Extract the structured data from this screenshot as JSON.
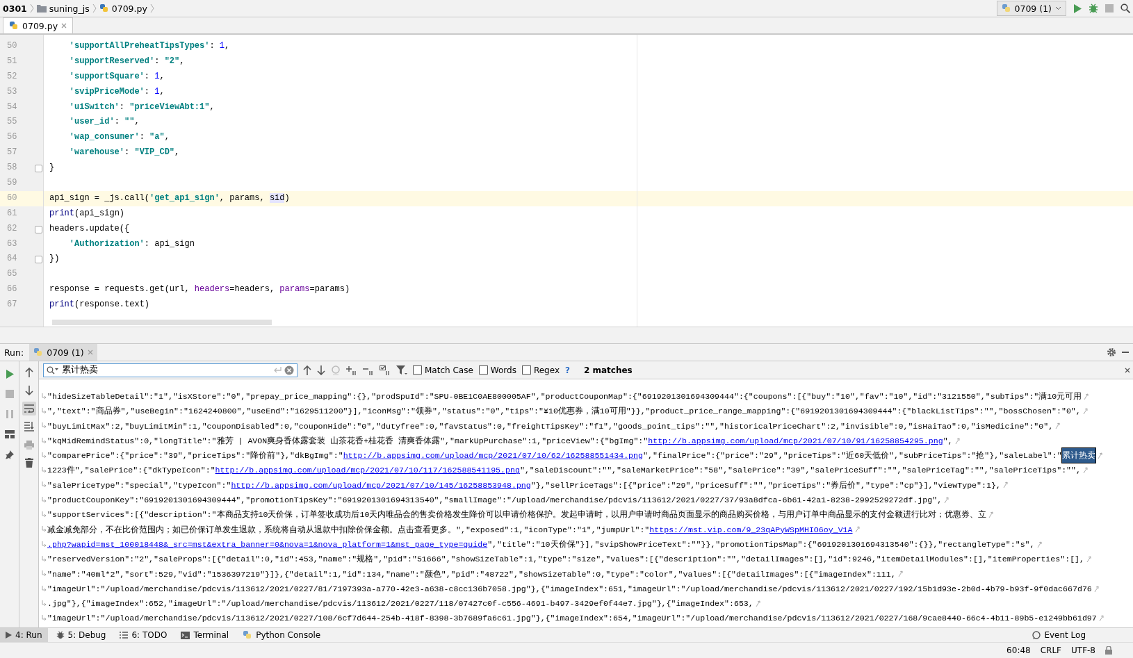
{
  "breadcrumbs": [
    {
      "label": "0301",
      "kind": "project"
    },
    {
      "label": "suning_js",
      "kind": "folder"
    },
    {
      "label": "0709.py",
      "kind": "file"
    }
  ],
  "run_config": {
    "label": "0709 (1)"
  },
  "editor_tabs": [
    {
      "label": "0709.py",
      "selected": true
    }
  ],
  "editor": {
    "lines": [
      {
        "number": "50",
        "tokens": [
          {
            "kind": "key",
            "text": "    'supportAllPreheatTipsTypes'"
          },
          {
            "kind": "plain",
            "text": ": "
          },
          {
            "kind": "num",
            "text": "1"
          },
          {
            "kind": "plain",
            "text": ","
          }
        ]
      },
      {
        "number": "51",
        "tokens": [
          {
            "kind": "key",
            "text": "    'supportReserved'"
          },
          {
            "kind": "plain",
            "text": ": "
          },
          {
            "kind": "key",
            "text": "\"2\""
          },
          {
            "kind": "plain",
            "text": ","
          }
        ]
      },
      {
        "number": "52",
        "tokens": [
          {
            "kind": "key",
            "text": "    'supportSquare'"
          },
          {
            "kind": "plain",
            "text": ": "
          },
          {
            "kind": "num",
            "text": "1"
          },
          {
            "kind": "plain",
            "text": ","
          }
        ]
      },
      {
        "number": "53",
        "tokens": [
          {
            "kind": "key",
            "text": "    'svipPriceMode'"
          },
          {
            "kind": "plain",
            "text": ": "
          },
          {
            "kind": "num",
            "text": "1"
          },
          {
            "kind": "plain",
            "text": ","
          }
        ]
      },
      {
        "number": "54",
        "tokens": [
          {
            "kind": "key",
            "text": "    'uiSwitch'"
          },
          {
            "kind": "plain",
            "text": ": "
          },
          {
            "kind": "key",
            "text": "\"priceViewAbt:1\""
          },
          {
            "kind": "plain",
            "text": ","
          }
        ]
      },
      {
        "number": "55",
        "tokens": [
          {
            "kind": "key",
            "text": "    'user_id'"
          },
          {
            "kind": "plain",
            "text": ": "
          },
          {
            "kind": "key",
            "text": "\"\""
          },
          {
            "kind": "plain",
            "text": ","
          }
        ]
      },
      {
        "number": "56",
        "tokens": [
          {
            "kind": "key",
            "text": "    'wap_consumer'"
          },
          {
            "kind": "plain",
            "text": ": "
          },
          {
            "kind": "key",
            "text": "\"a\""
          },
          {
            "kind": "plain",
            "text": ","
          }
        ]
      },
      {
        "number": "57",
        "tokens": [
          {
            "kind": "key",
            "text": "    'warehouse'"
          },
          {
            "kind": "plain",
            "text": ": "
          },
          {
            "kind": "key",
            "text": "\"VIP_CD\""
          },
          {
            "kind": "plain",
            "text": ","
          }
        ]
      },
      {
        "number": "58",
        "fold": true,
        "tokens": [
          {
            "kind": "plain",
            "text": "}"
          }
        ]
      },
      {
        "number": "59"
      },
      {
        "number": "60",
        "current": true,
        "tokens": [
          {
            "kind": "plain",
            "text": "api_sign = _js.call("
          },
          {
            "kind": "key",
            "text": "'get_api_sign'"
          },
          {
            "kind": "plain",
            "text": ", params, "
          },
          {
            "kind": "usage",
            "text": "sid"
          },
          {
            "kind": "plain",
            "text": ")"
          }
        ]
      },
      {
        "number": "61",
        "tokens": [
          {
            "kind": "builtin",
            "text": "print"
          },
          {
            "kind": "plain",
            "text": "(api_sign)"
          }
        ]
      },
      {
        "number": "62",
        "fold": true,
        "tokens": [
          {
            "kind": "plain",
            "text": "headers.update({"
          }
        ]
      },
      {
        "number": "63",
        "tokens": [
          {
            "kind": "key",
            "text": "    'Authorization'"
          },
          {
            "kind": "plain",
            "text": ": api_sign"
          }
        ]
      },
      {
        "number": "64",
        "fold": true,
        "tokens": [
          {
            "kind": "plain",
            "text": "})"
          }
        ]
      },
      {
        "number": "65"
      },
      {
        "number": "66",
        "tokens": [
          {
            "kind": "plain",
            "text": "response = requests.get(url, "
          },
          {
            "kind": "param",
            "text": "headers"
          },
          {
            "kind": "plain",
            "text": "=headers, "
          },
          {
            "kind": "param",
            "text": "params"
          },
          {
            "kind": "plain",
            "text": "=params)"
          }
        ]
      },
      {
        "number": "67",
        "tokens": [
          {
            "kind": "builtin",
            "text": "print"
          },
          {
            "kind": "plain",
            "text": "(response.text)"
          }
        ]
      }
    ]
  },
  "run_panel": {
    "title": "Run:",
    "tabs": [
      {
        "label": "0709 (1)",
        "selected": true
      }
    ],
    "search": {
      "value": "累计热卖",
      "options": [
        {
          "label": "Match Case",
          "checked": false
        },
        {
          "label": "Words",
          "checked": false
        },
        {
          "label": "Regex",
          "checked": false
        }
      ],
      "help": "?",
      "match_count": "2 matches"
    },
    "soft_wrap_on": true,
    "console_lines": [
      [
        {
          "kind": "text",
          "text": "\"hideSizeTableDetail\":\"1\",\"isXStore\":\"0\",\"prepay_price_mapping\":{},\"prodSpuId\":\"SPU-0BE1C0AE800005AF\",\"productCouponMap\":{\"6919201301694309444\":{\"coupons\":[{\"buy\":\"10\",\"fav\":\"10\",\"id\":\"3121550\",\"subTips\":\"满10元可用"
        }
      ],
      [
        {
          "kind": "text",
          "text": "\",\"text\":\"商品券\",\"useBegin\":\"1624240800\",\"useEnd\":\"1629511200\"}],\"iconMsg\":\"领券\",\"status\":\"0\",\"tips\":\"¥10优惠券，满10可用\"}},\"product_price_range_mapping\":{\"6919201301694309444\":{\"blackListTips\":\"\",\"bossChosen\":\"0\","
        }
      ],
      [
        {
          "kind": "text",
          "text": "\"buyLimitMax\":2,\"buyLimitMin\":1,\"couponDisabled\":0,\"couponHide\":\"0\",\"dutyfree\":0,\"favStatus\":0,\"freightTipsKey\":\"f1\",\"goods_point_tips\":\"\",\"historicalPriceChart\":2,\"invisible\":0,\"isHaiTao\":0,\"isMedicine\":\"0\","
        }
      ],
      [
        {
          "kind": "text",
          "text": "\"kqMidRemindStatus\":0,\"longTitle\":\"雅芳 | AVON爽身香体露套装 山茶花香+桂花香 清爽香体露\",\"markUpPurchase\":1,\"priceView\":{\"bgImg\":\""
        },
        {
          "kind": "link",
          "text": "http://b.appsimg.com/upload/mcp/2021/07/10/91/16258854295.png"
        },
        {
          "kind": "text",
          "text": "\","
        }
      ],
      [
        {
          "kind": "text",
          "text": "\"comparePrice\":{\"price\":\"39\",\"priceTips\":\"降价前\"},\"dkBgImg\":\""
        },
        {
          "kind": "link",
          "text": "http://b.appsimg.com/upload/mcp/2021/07/10/62/162588551434.png"
        },
        {
          "kind": "text",
          "text": "\",\"finalPrice\":{\"price\":\"29\",\"priceTips\":\"近60天低价\",\"subPriceTips\":\"抢\"},\"saleLabel\":\""
        },
        {
          "kind": "match",
          "text": "累计热卖"
        }
      ],
      [
        {
          "kind": "text",
          "text": "1223件\",\"salePrice\":{\"dkTypeIcon\":\""
        },
        {
          "kind": "link",
          "text": "http://b.appsimg.com/upload/mcp/2021/07/10/117/162588541195.png"
        },
        {
          "kind": "text",
          "text": "\",\"saleDiscount\":\"\",\"saleMarketPrice\":\"58\",\"salePrice\":\"39\",\"salePriceSuff\":\"\",\"salePriceTag\":\"\",\"salePriceTips\":\"\","
        }
      ],
      [
        {
          "kind": "text",
          "text": "\"salePriceType\":\"special\",\"typeIcon\":\""
        },
        {
          "kind": "link",
          "text": "http://b.appsimg.com/upload/mcp/2021/07/10/145/16258853948.png"
        },
        {
          "kind": "text",
          "text": "\"},\"sellPriceTags\":[{\"price\":\"29\",\"priceSuff\":\"\",\"priceTips\":\"券后价\",\"type\":\"cp\"}],\"viewType\":1},"
        }
      ],
      [
        {
          "kind": "text",
          "text": "\"productCouponKey\":\"6919201301694309444\",\"promotionTipsKey\":\"6919201301694313540\",\"smallImage\":\"/upload/merchandise/pdcvis/113612/2021/0227/37/93a8dfca-6b61-42a1-8238-2992529272df.jpg\","
        }
      ],
      [
        {
          "kind": "text",
          "text": "\"supportServices\":[{\"description\":\"本商品支持10天价保，订单签收成功后10天内唯品会的售卖价格发生降价可以申请价格保护。发起申请时，以用户申请时商品页面显示的商品购买价格，与用户订单中商品显示的支付金额进行比对；优惠券、立"
        }
      ],
      [
        {
          "kind": "text",
          "text": "减金减免部分，不在比价范围内；如已价保订单发生退款，系统将自动从退款中扣除价保金额。点击查看更多。\",\"exposed\":1,\"iconType\":\"1\",\"jumpUrl\":\""
        },
        {
          "kind": "link",
          "text": "https://mst.vip.com/9_23qAPyWSpMHIO6oy_V1A"
        }
      ],
      [
        {
          "kind": "link",
          "text": ".php?wapid=mst_100018448&_src=mst&extra_banner=0&nova=1&nova_platform=1&mst_page_type=guide"
        },
        {
          "kind": "text",
          "text": "\",\"title\":\"10天价保\"}],\"svipShowPriceText\":\"\"}},\"promotionTipsMap\":{\"6919201301694313540\":{}},\"rectangleType\":\"s\","
        }
      ],
      [
        {
          "kind": "text",
          "text": "\"reservedVersion\":\"2\",\"saleProps\":[{\"detail\":0,\"id\":453,\"name\":\"规格\",\"pid\":\"51666\",\"showSizeTable\":1,\"type\":\"size\",\"values\":[{\"description\":\"\",\"detailImages\":[],\"id\":9246,\"itemDetailModules\":[],\"itemProperties\":[],"
        }
      ],
      [
        {
          "kind": "text",
          "text": "\"name\":\"40ml*2\",\"sort\":529,\"vid\":\"1536397219\"}]},{\"detail\":1,\"id\":134,\"name\":\"颜色\",\"pid\":\"48722\",\"showSizeTable\":0,\"type\":\"color\",\"values\":[{\"detailImages\":[{\"imageIndex\":111,"
        }
      ],
      [
        {
          "kind": "text",
          "text": "\"imageUrl\":\"/upload/merchandise/pdcvis/113612/2021/0227/81/7197393a-a770-42e3-a638-c8cc136b7058.jpg\"},{\"imageIndex\":651,\"imageUrl\":\"/upload/merchandise/pdcvis/113612/2021/0227/192/15b1d93e-2b0d-4b79-b93f-9f0dac667d76"
        }
      ],
      [
        {
          "kind": "text",
          "text": ".jpg\"},{\"imageIndex\":652,\"imageUrl\":\"/upload/merchandise/pdcvis/113612/2021/0227/118/07427c0f-c556-4691-b497-3429ef0f44e7.jpg\"},{\"imageIndex\":653,"
        }
      ],
      [
        {
          "kind": "text",
          "text": "\"imageUrl\":\"/upload/merchandise/pdcvis/113612/2021/0227/108/6cf7d644-254b-418f-8398-3b7689fa6c61.jpg\"},{\"imageIndex\":654,\"imageUrl\":\"/upload/merchandise/pdcvis/113612/2021/0227/168/9cae8440-66c4-4b11-89b5-e1249bb61d97"
        }
      ]
    ]
  },
  "tool_tabs": [
    {
      "label": "4: Run",
      "kind": "run",
      "selected": true
    },
    {
      "label": "5: Debug",
      "kind": "debug",
      "selected": false
    },
    {
      "label": "6: TODO",
      "kind": "todo",
      "selected": false
    },
    {
      "label": "Terminal",
      "kind": "terminal",
      "selected": false
    },
    {
      "label": "Python Console",
      "kind": "python",
      "selected": false
    }
  ],
  "status_bar": {
    "event_log": "Event Log",
    "position": "60:48",
    "line_separator": "CRLF",
    "encoding": "UTF-8"
  }
}
